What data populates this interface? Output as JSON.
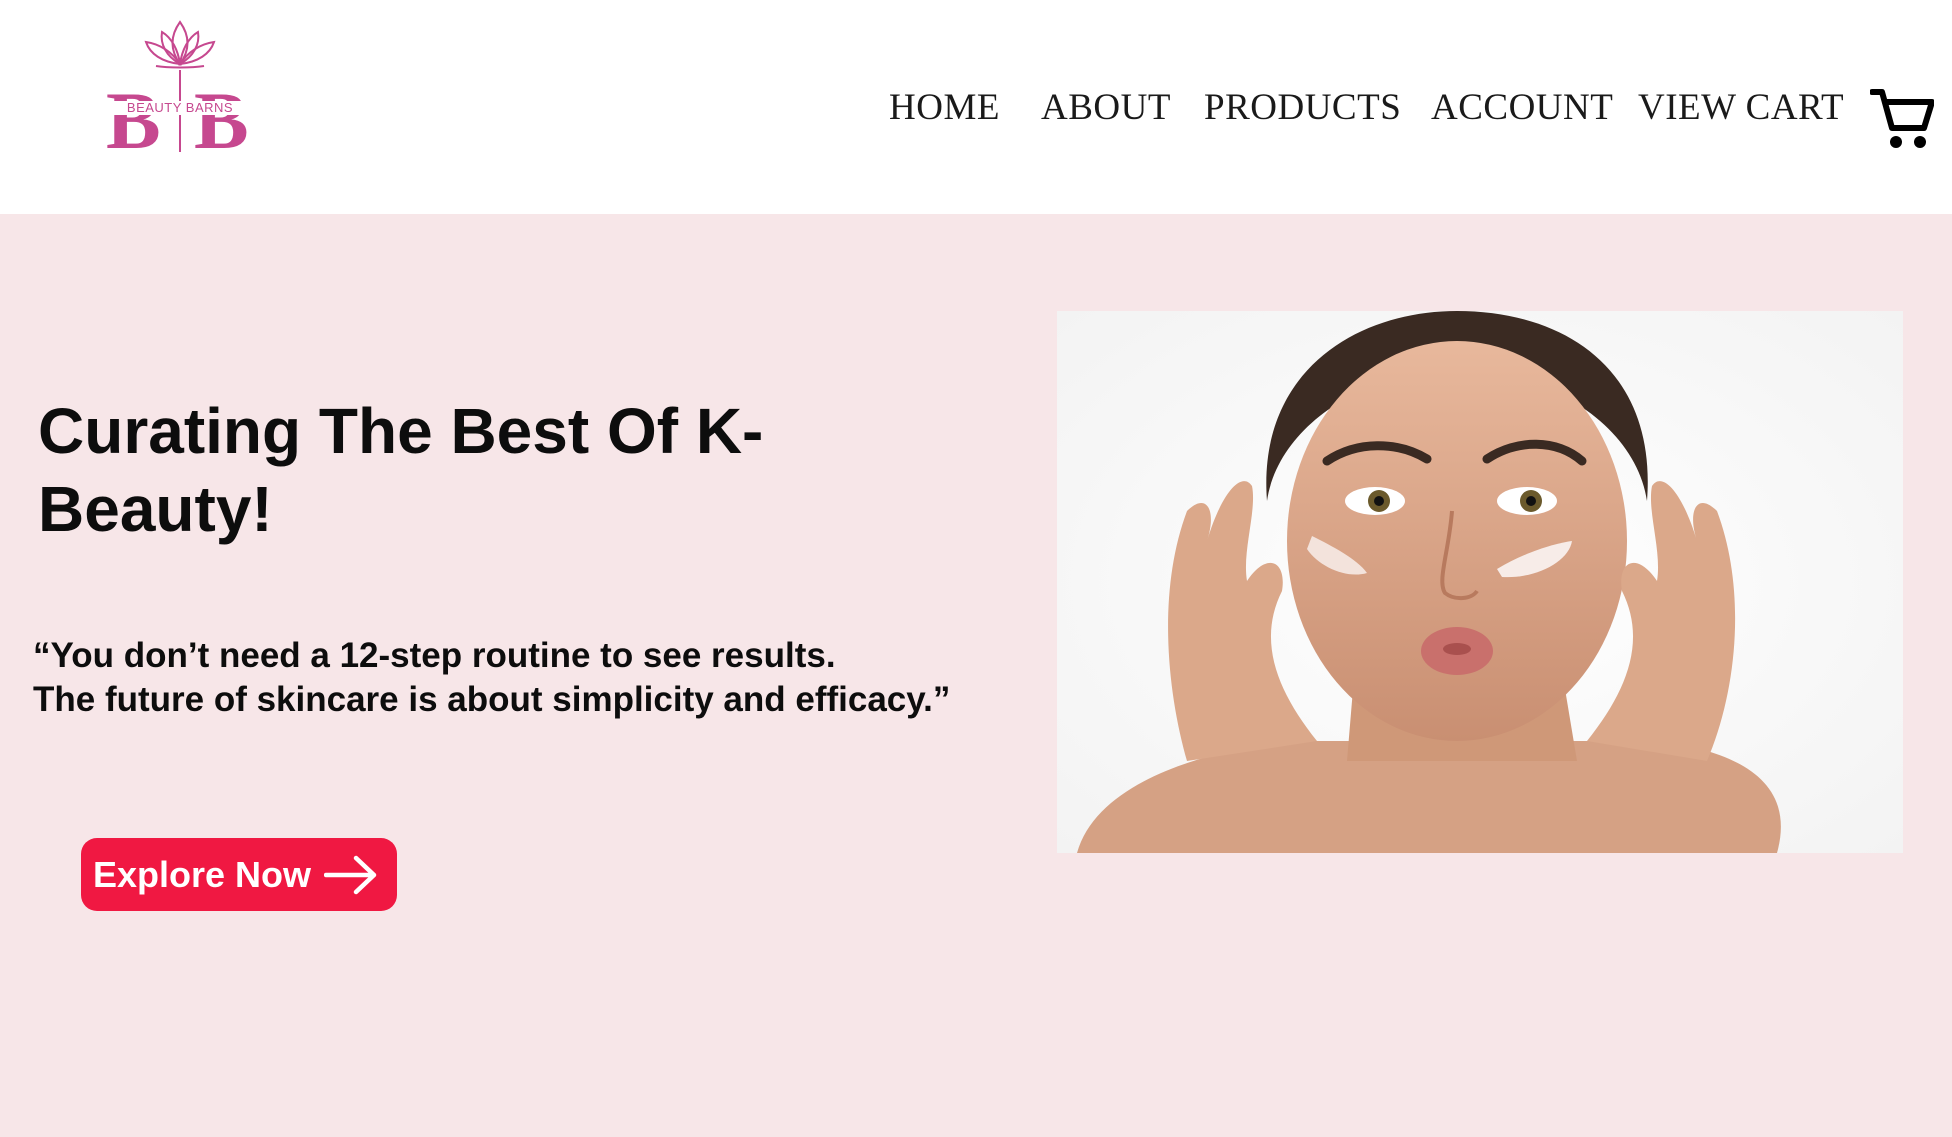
{
  "brand": {
    "name": "BEAUTY BARNS",
    "monogram": "B B",
    "color": "#c6488f"
  },
  "nav": {
    "items": [
      {
        "label": "HOME"
      },
      {
        "label": "ABOUT"
      },
      {
        "label": "PRODUCTS"
      },
      {
        "label": "ACCOUNT"
      },
      {
        "label": "VIEW CART"
      }
    ],
    "cart_icon": "shopping-cart-icon"
  },
  "hero": {
    "title": "Curating The Best Of K-Beauty!",
    "quote_line1": "“You don’t need a 12-step routine to see results.",
    "quote_line2": "The future of skincare is about simplicity and efficacy.”",
    "cta_label": "Explore Now",
    "cta_icon": "arrow-right-icon",
    "image_subject": "woman-applying-cream-photo"
  },
  "colors": {
    "page_background": "#f7e6e8",
    "header_background": "#ffffff",
    "cta_background": "#f01842",
    "text": "#0d0d0d"
  }
}
